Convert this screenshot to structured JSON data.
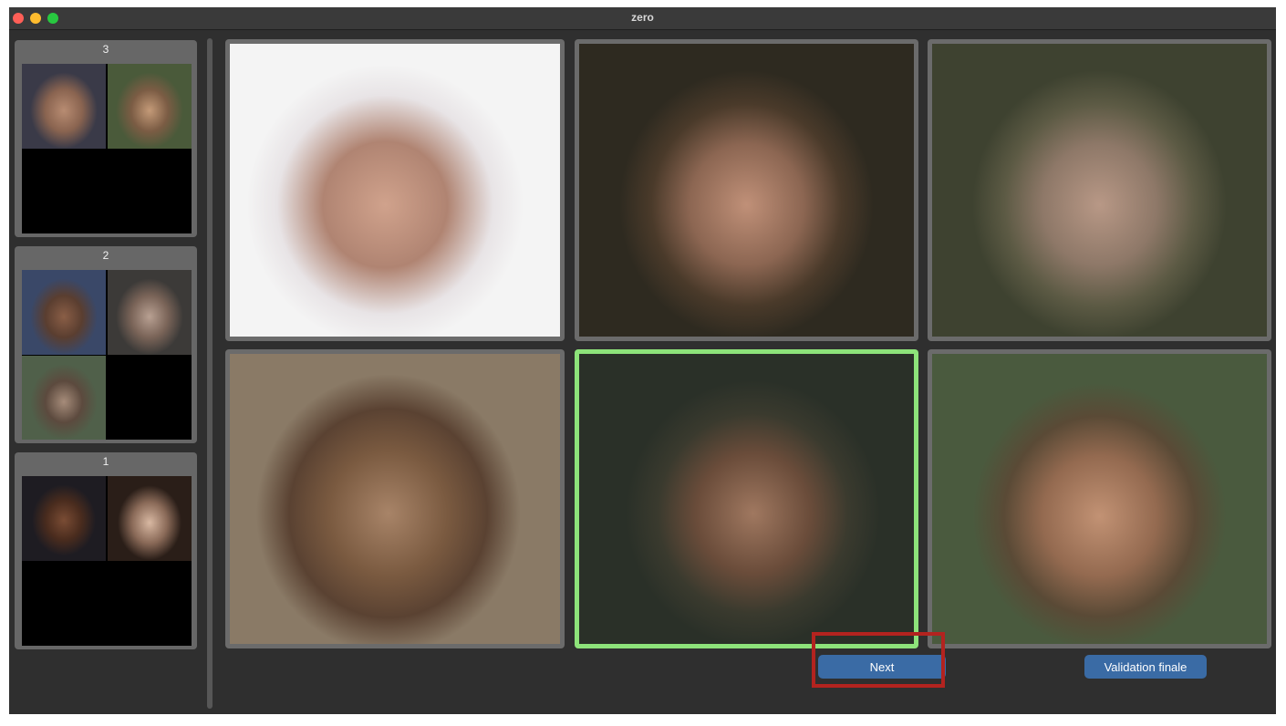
{
  "window": {
    "title": "zero"
  },
  "sidebar": {
    "groups": [
      {
        "label": "3"
      },
      {
        "label": "2"
      },
      {
        "label": "1"
      }
    ]
  },
  "grid": {
    "selected_index": 4
  },
  "actions": {
    "next_label": "Next",
    "validate_label": "Validation finale"
  },
  "colors": {
    "accent": "#3a6ba5",
    "selected_border": "#8de37a",
    "highlight": "#b3231f"
  }
}
